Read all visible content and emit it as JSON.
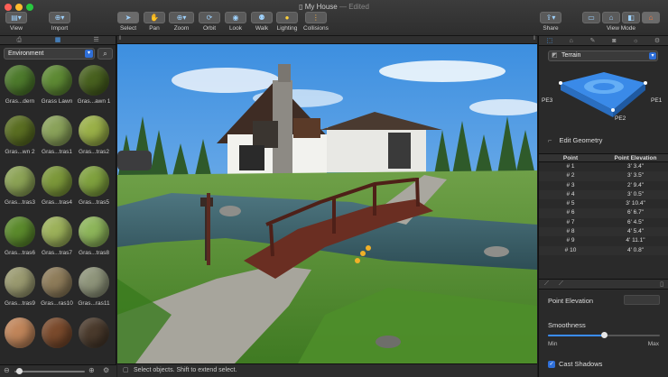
{
  "window": {
    "title": "My House",
    "status": "Edited",
    "colors": {
      "close": "#fe5f57",
      "minimize": "#febc2e",
      "maximize": "#28c840"
    }
  },
  "toolbar": {
    "view": "View",
    "import": "Import",
    "select": "Select",
    "pan": "Pan",
    "zoom": "Zoom",
    "orbit": "Orbit",
    "look": "Look",
    "walk": "Walk",
    "lighting": "Lighting",
    "collisions": "Collisions",
    "share": "Share",
    "view_mode": "View Mode"
  },
  "library": {
    "category": "Environment",
    "materials": [
      {
        "label": "Gras...dern",
        "color": "#4d7a2c"
      },
      {
        "label": "Grass Lawn",
        "color": "#5e8a34"
      },
      {
        "label": "Gras...awn 1",
        "color": "#48611f"
      },
      {
        "label": "Gras...wn 2",
        "color": "#5a6e22"
      },
      {
        "label": "Gras...tras1",
        "color": "#8aa25a"
      },
      {
        "label": "Gras...tras2",
        "color": "#9ab048"
      },
      {
        "label": "Gras...tras3",
        "color": "#8ca356"
      },
      {
        "label": "Gras...tras4",
        "color": "#7c983a"
      },
      {
        "label": "Gras...tras5",
        "color": "#7fa13e"
      },
      {
        "label": "Gras...tras6",
        "color": "#5b8a2c"
      },
      {
        "label": "Gras...tras7",
        "color": "#9cb15a"
      },
      {
        "label": "Gras...tras8",
        "color": "#8db55a"
      },
      {
        "label": "Gras...tras9",
        "color": "#9a9a70"
      },
      {
        "label": "Gras...ras10",
        "color": "#8e7c5a"
      },
      {
        "label": "Gras...ras11",
        "color": "#8e947a"
      },
      {
        "label": "",
        "color": "#c0855a"
      },
      {
        "label": "",
        "color": "#7a4a2c"
      },
      {
        "label": "",
        "color": "#4a3a2c"
      }
    ]
  },
  "status_bar": {
    "message": "Select objects. Shift to extend select."
  },
  "inspector": {
    "terrain_label": "Terrain",
    "diagram_labels": {
      "pe1": "PE1",
      "pe2": "PE2",
      "pe3": "PE3"
    },
    "edit_geometry": "Edit Geometry",
    "table": {
      "col_point": "Point",
      "col_elevation": "Point Elevation",
      "rows": [
        {
          "point": "# 1",
          "elevation": "3' 3.4\""
        },
        {
          "point": "# 2",
          "elevation": "3' 3.5\""
        },
        {
          "point": "# 3",
          "elevation": "2' 9.4\""
        },
        {
          "point": "# 4",
          "elevation": "3' 0.5\""
        },
        {
          "point": "# 5",
          "elevation": "3' 10.4\""
        },
        {
          "point": "# 6",
          "elevation": "6' 6.7\""
        },
        {
          "point": "# 7",
          "elevation": "6' 4.5\""
        },
        {
          "point": "# 8",
          "elevation": "4' 5.4\""
        },
        {
          "point": "# 9",
          "elevation": "4' 11.1\""
        },
        {
          "point": "# 10",
          "elevation": "4' 0.8\""
        }
      ]
    },
    "point_elevation_label": "Point Elevation",
    "smoothness_label": "Smoothness",
    "smoothness_value": 0.5,
    "smooth_min": "Min",
    "smooth_max": "Max",
    "cast_shadows": "Cast Shadows"
  }
}
